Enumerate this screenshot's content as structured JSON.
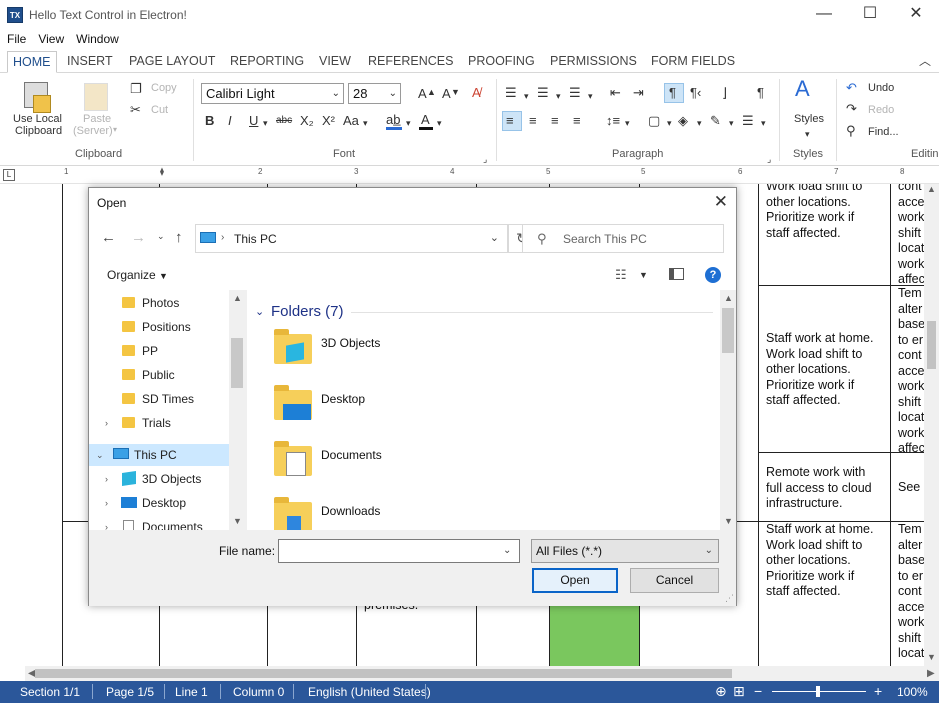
{
  "window": {
    "logo": "TX",
    "title": "Hello Text Control in Electron!",
    "controls": {
      "minimize": "—",
      "maximize": "☐",
      "close": "✕"
    }
  },
  "menu": [
    "File",
    "View",
    "Window"
  ],
  "ribbon_tabs": [
    {
      "label": "HOME",
      "active": true
    },
    {
      "label": "INSERT"
    },
    {
      "label": "PAGE LAYOUT"
    },
    {
      "label": "REPORTING"
    },
    {
      "label": "VIEW"
    },
    {
      "label": "REFERENCES"
    },
    {
      "label": "PROOFING"
    },
    {
      "label": "PERMISSIONS"
    },
    {
      "label": "FORM FIELDS"
    }
  ],
  "ribbon": {
    "clipboard": {
      "group_label": "Clipboard",
      "use_local_line1": "Use Local",
      "use_local_line2": "Clipboard",
      "paste_line1": "Paste",
      "paste_line2": "(Server)",
      "copy": "Copy",
      "cut": "Cut"
    },
    "font": {
      "group_label": "Font",
      "family": "Calibri Light",
      "size": "28",
      "buttons": {
        "bold": "B",
        "italic": "I",
        "underline": "U",
        "strike": "abc",
        "subscript": "X₂",
        "superscript": "X²",
        "case": "Aa",
        "grow": "A",
        "shrink": "A"
      }
    },
    "paragraph": {
      "group_label": "Paragraph",
      "pilcrow": "¶"
    },
    "styles": {
      "group_label": "Styles",
      "button": "Styles"
    },
    "editing": {
      "group_label": "Editing",
      "undo": "Undo",
      "redo": "Redo",
      "find": "Find..."
    }
  },
  "document": {
    "cells": [
      {
        "text": "Work load shift to\nother locations.\nPrioritize work if\nstaff affected."
      },
      {
        "text": "Staff work at home.\nWork load shift to\nother locations.\nPrioritize work if\nstaff affected."
      },
      {
        "text": "Remote work with\nfull access to cloud\ninfrastructure."
      },
      {
        "text": "Staff work at home.\nWork load shift to\nother locations.\nPrioritize work if\nstaff affected."
      },
      {
        "text": "premises."
      }
    ],
    "right_col": [
      {
        "text": "cont\nacce\nwork\nshift\nlocat\nwork\naffec"
      },
      {
        "text": "Tem\nalter\nbase\nto er\ncont\nacce\nwork\nshift\nlocat\nwork\naffec"
      },
      {
        "text": "See"
      },
      {
        "text": "Tem\nalter\nbase\nto er\ncont\nacce\nwork\nshift\nlocat"
      }
    ],
    "fill_color": "#7ac75e"
  },
  "status": {
    "section": "Section 1/1",
    "page": "Page 1/5",
    "line": "Line 1",
    "column": "Column 0",
    "language": "English (United States)",
    "zoom": "100%",
    "zoom_minus": "−",
    "zoom_plus": "+",
    "bg_color": "#2b579a"
  },
  "dialog": {
    "title": "Open",
    "close": "✕",
    "address": "This PC",
    "search_placeholder": "Search This PC",
    "organize": "Organize",
    "help": "?",
    "nav_items": [
      {
        "label": "Photos",
        "icon": "folder-icon"
      },
      {
        "label": "Positions",
        "icon": "folder-icon"
      },
      {
        "label": "PP",
        "icon": "folder-icon"
      },
      {
        "label": "Public",
        "icon": "folder-icon"
      },
      {
        "label": "SD Times",
        "icon": "folder-icon"
      },
      {
        "label": "Trials",
        "icon": "folder-icon"
      },
      {
        "label": "This PC",
        "icon": "computer-icon"
      },
      {
        "label": "3D Objects",
        "icon": "cube-icon"
      },
      {
        "label": "Desktop",
        "icon": "desktop-icon"
      },
      {
        "label": "Documents",
        "icon": "document-icon"
      }
    ],
    "folders_heading": "Folders (7)",
    "folders": [
      {
        "name": "3D Objects"
      },
      {
        "name": "Desktop"
      },
      {
        "name": "Documents"
      },
      {
        "name": "Downloads"
      }
    ],
    "file_name_label": "File name:",
    "file_name_value": "",
    "file_type": "All Files (*.*)",
    "open_button": "Open",
    "cancel_button": "Cancel"
  }
}
